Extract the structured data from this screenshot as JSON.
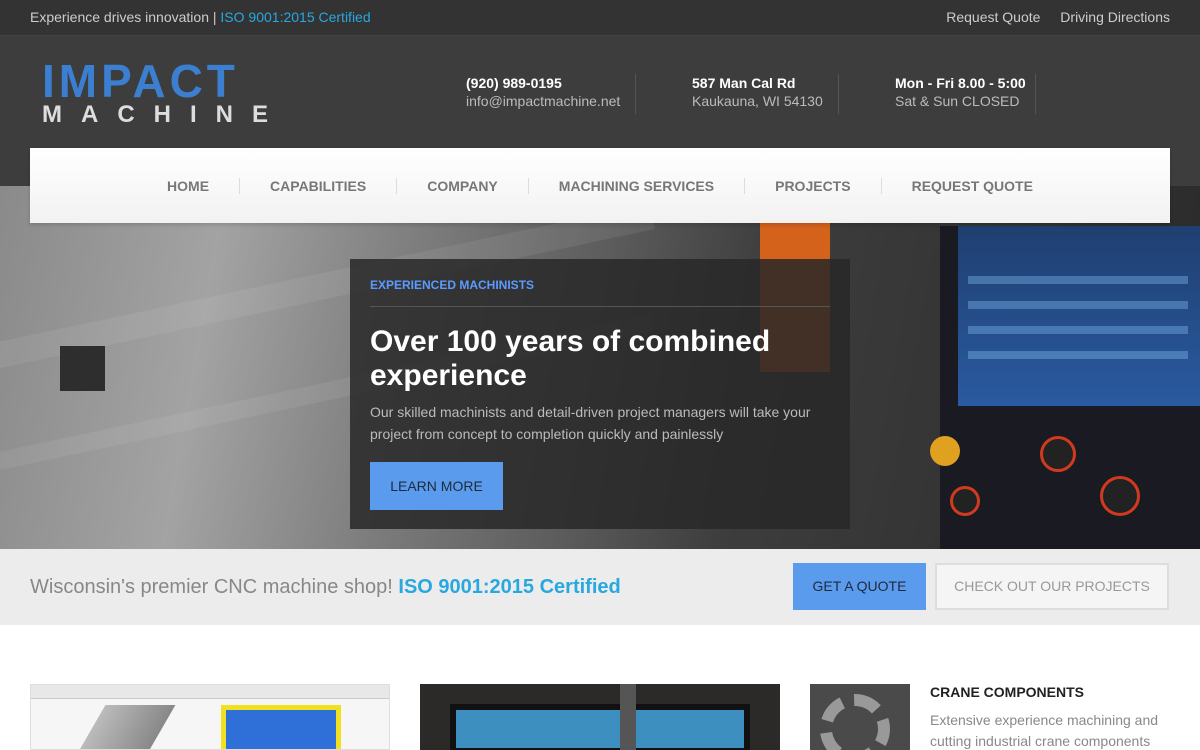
{
  "topbar": {
    "tagline": "Experience drives innovation | ",
    "certification": "ISO 9001:2015 Certified",
    "links": [
      "Request Quote",
      "Driving Directions"
    ]
  },
  "logo": {
    "line1": "IMPACT",
    "line2": "MACHINE"
  },
  "contact": {
    "phone": "(920) 989-0195",
    "email": "info@impactmachine.net",
    "street": "587 Man Cal Rd",
    "city": "Kaukauna, WI 54130",
    "hours_weekday": "Mon - Fri 8.00 - 5:00",
    "hours_weekend": "Sat & Sun CLOSED"
  },
  "nav": {
    "items": [
      "HOME",
      "CAPABILITIES",
      "COMPANY",
      "MACHINING SERVICES",
      "PROJECTS",
      "REQUEST QUOTE"
    ]
  },
  "hero": {
    "kicker": "EXPERIENCED MACHINISTS",
    "headline": "Over 100 years of combined experience",
    "description": "Our skilled machinists and detail-driven project managers will take your project from concept to completion quickly and painlessly",
    "button_label": "LEARN MORE"
  },
  "cta": {
    "message": "Wisconsin's premier CNC machine shop! ",
    "certification": "ISO 9001:2015 Certified",
    "quote_button": "GET A QUOTE",
    "projects_button": "CHECK OUT OUR PROJECTS"
  },
  "cards": {
    "card3_title": "CRANE COMPONENTS",
    "card3_description": "Extensive experience machining and cutting industrial crane components"
  },
  "colors": {
    "accent_blue": "#5b9bee",
    "cert_blue": "#29a8e0",
    "logo_blue": "#3c7fd0",
    "header_bg": "#3d3d3d"
  }
}
